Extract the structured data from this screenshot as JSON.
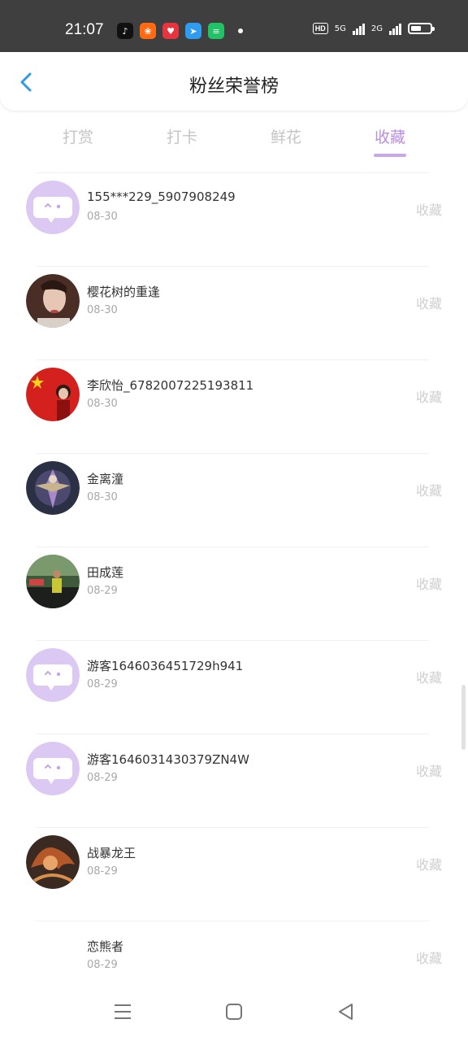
{
  "status_bar": {
    "time": "21:07",
    "hd_label": "HD",
    "net1_label": "5G",
    "net2_label": "2G",
    "battery_level": 0.55
  },
  "header": {
    "title": "粉丝荣誉榜"
  },
  "tabs": [
    {
      "label": "打赏",
      "active": false
    },
    {
      "label": "打卡",
      "active": false
    },
    {
      "label": "鲜花",
      "active": false
    },
    {
      "label": "收藏",
      "active": true
    }
  ],
  "list": [
    {
      "name": "155***229_5907908249",
      "date": "08-30",
      "kind": "收藏",
      "avatar": "default-chat-avatar"
    },
    {
      "name": "樱花树的重逢",
      "date": "08-30",
      "kind": "收藏",
      "avatar": "photo-avatar"
    },
    {
      "name": "李欣怡_6782007225193811",
      "date": "08-30",
      "kind": "收藏",
      "avatar": "flag-photo-avatar"
    },
    {
      "name": "金离潼",
      "date": "08-30",
      "kind": "收藏",
      "avatar": "game-art-avatar"
    },
    {
      "name": "田成莲",
      "date": "08-29",
      "kind": "收藏",
      "avatar": "outdoor-photo-avatar"
    },
    {
      "name": "游客1646036451729h941",
      "date": "08-29",
      "kind": "收藏",
      "avatar": "default-chat-avatar"
    },
    {
      "name": "游客1646031430379ZN4W",
      "date": "08-29",
      "kind": "收藏",
      "avatar": "default-chat-avatar"
    },
    {
      "name": "战暴龙王",
      "date": "08-29",
      "kind": "收藏",
      "avatar": "dragon-art-avatar"
    },
    {
      "name": "恋熊者",
      "date": "08-29",
      "kind": "收藏",
      "avatar": "blank-avatar"
    }
  ],
  "colors": {
    "accent": "#b98ee0",
    "avatar_default": "#dcc9f3",
    "status_bar": "#3f3f3f",
    "back_arrow": "#2e9be6"
  }
}
